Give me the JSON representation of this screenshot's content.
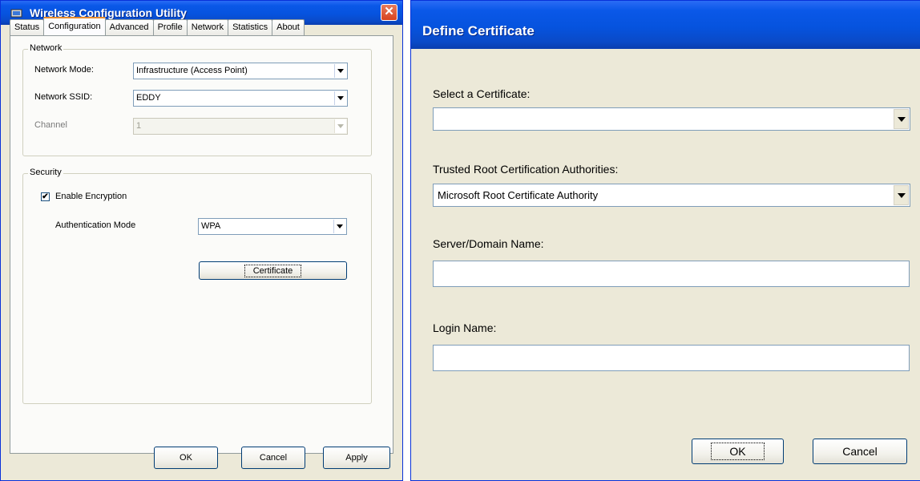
{
  "left_window": {
    "title": "Wireless Configuration Utility",
    "close_glyph": "✕",
    "tabs": [
      {
        "label": "Status",
        "active": false
      },
      {
        "label": "Configuration",
        "active": true
      },
      {
        "label": "Advanced",
        "active": false
      },
      {
        "label": "Profile",
        "active": false
      },
      {
        "label": "Network",
        "active": false
      },
      {
        "label": "Statistics",
        "active": false
      },
      {
        "label": "About",
        "active": false
      }
    ],
    "network_group": {
      "label": "Network",
      "mode_label": "Network Mode:",
      "mode_value": "Infrastructure (Access Point)",
      "ssid_label": "Network SSID:",
      "ssid_value": "EDDY",
      "channel_label": "Channel",
      "channel_value": "1"
    },
    "security_group": {
      "label": "Security",
      "encryption_label": "Enable Encryption",
      "encryption_checked": true,
      "check_glyph": "✔",
      "auth_label": "Authentication Mode",
      "auth_value": "WPA",
      "certificate_button": "Certificate"
    },
    "footer": {
      "ok": "OK",
      "cancel": "Cancel",
      "apply": "Apply"
    }
  },
  "right_window": {
    "title": "Define Certificate",
    "select_certificate_label": "Select a Certificate:",
    "select_certificate_value": "",
    "trusted_root_label": "Trusted Root Certification Authorities:",
    "trusted_root_value": "Microsoft Root Certificate Authority",
    "server_domain_label": "Server/Domain Name:",
    "server_domain_value": "",
    "login_label": "Login Name:",
    "login_value": "",
    "ok": "OK",
    "cancel": "Cancel"
  }
}
